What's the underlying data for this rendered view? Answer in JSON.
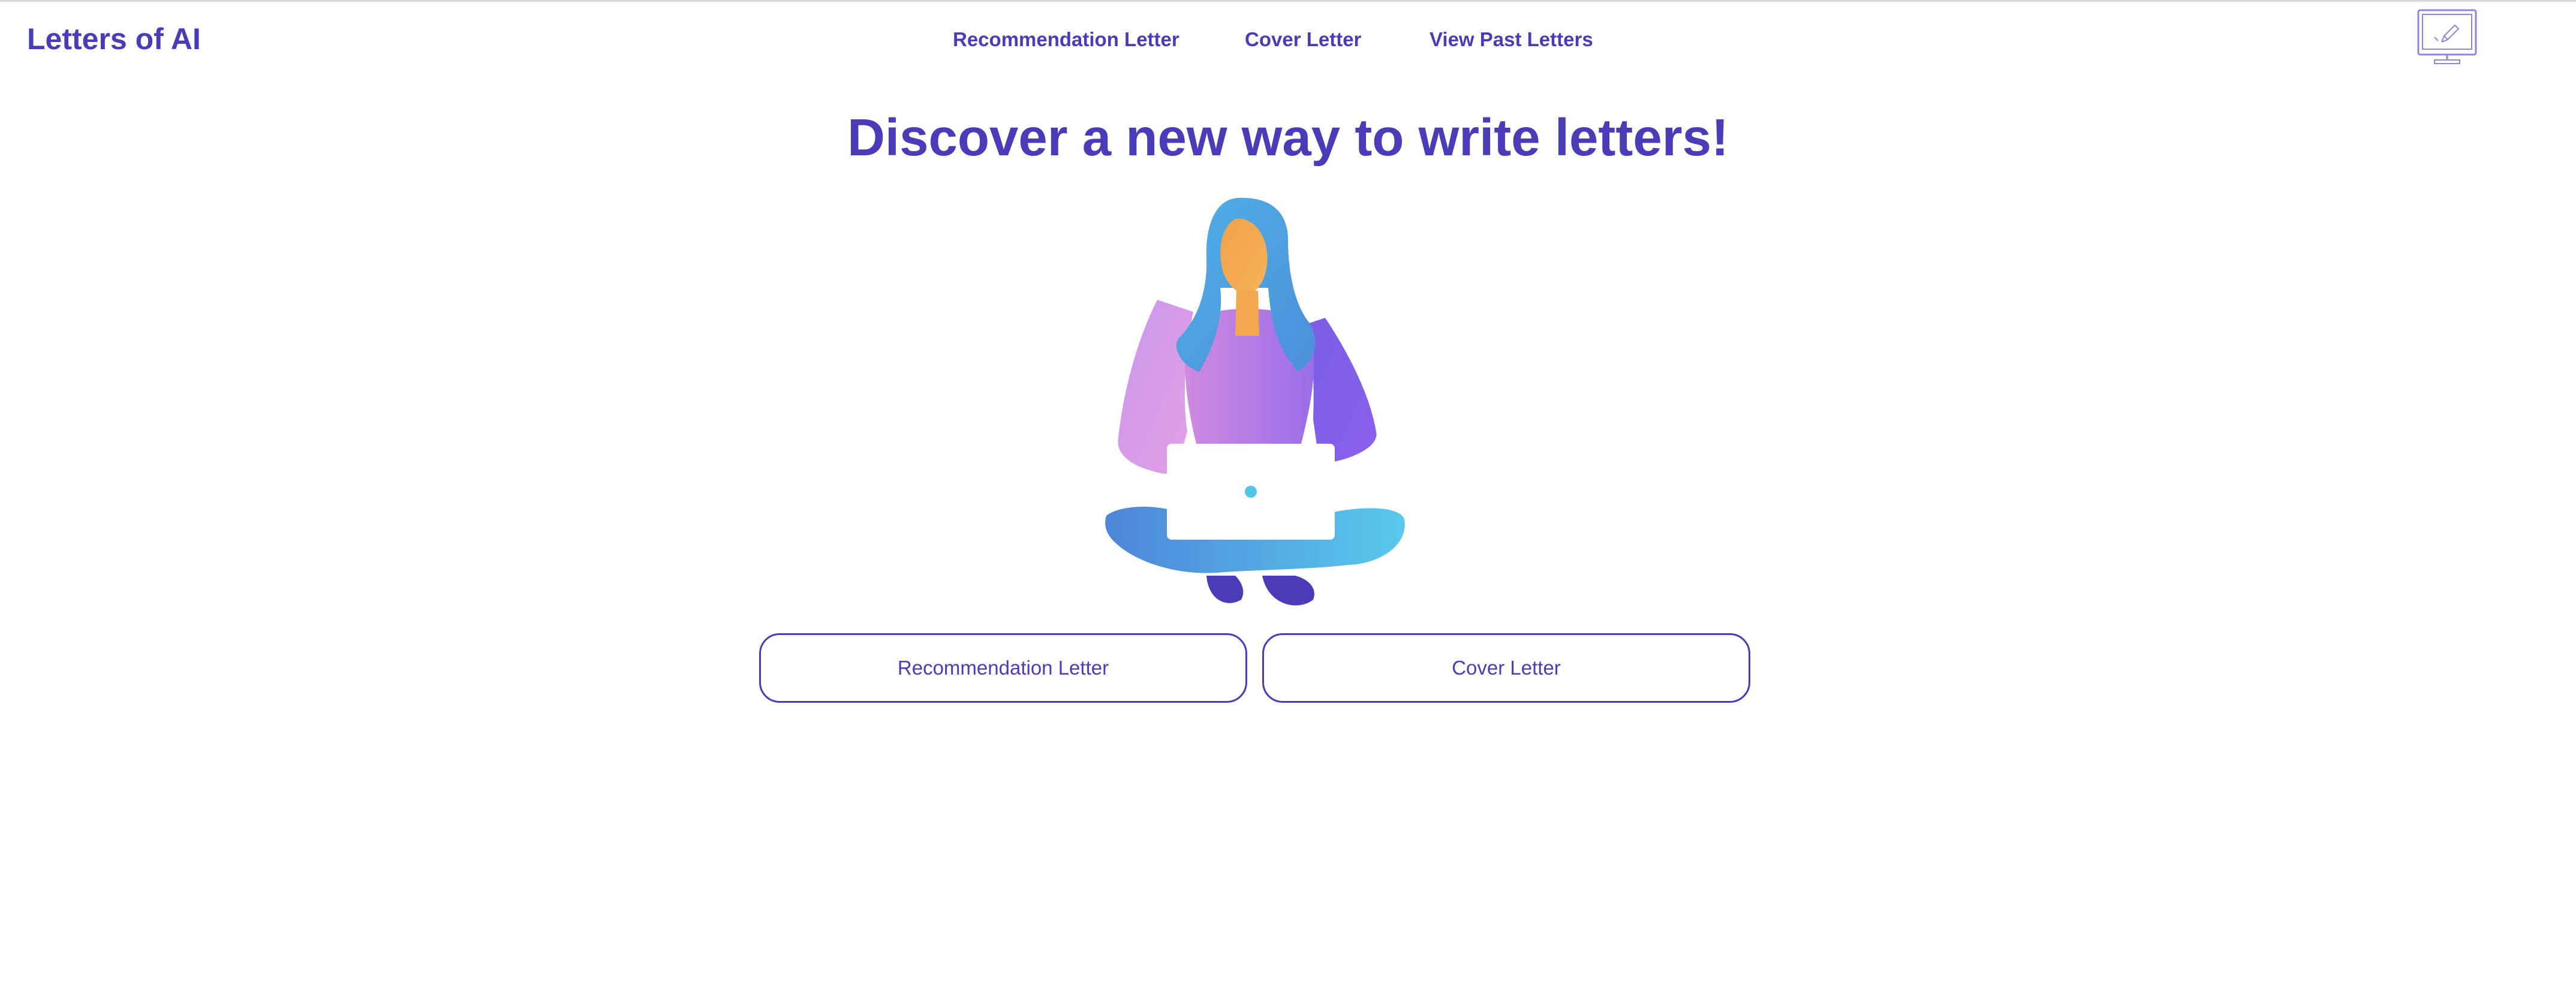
{
  "header": {
    "brand": "Letters of AI",
    "nav": {
      "recommendation": "Recommendation Letter",
      "cover": "Cover Letter",
      "past": "View Past Letters"
    },
    "monitor_icon": "monitor-pen-icon"
  },
  "hero": {
    "headline": "Discover a new way to write letters!",
    "illustration": "woman-with-laptop-illustration"
  },
  "actions": {
    "recommendation": "Recommendation Letter",
    "cover": "Cover Letter"
  },
  "colors": {
    "accent": "#4a3cb8",
    "background": "#ffffff"
  }
}
